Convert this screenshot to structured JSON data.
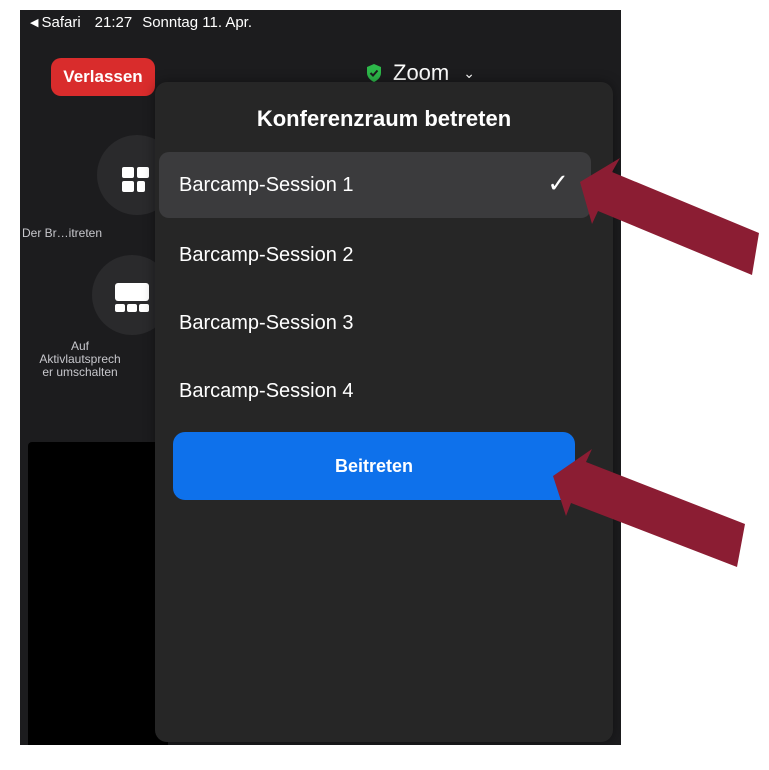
{
  "status_bar": {
    "back_app": "Safari",
    "time": "21:27",
    "date": "Sonntag 11. Apr."
  },
  "header": {
    "leave_label": "Verlassen",
    "meeting_title": "Zoom"
  },
  "side_buttons": {
    "breakout_label": "Der Br…itreten",
    "speaker_label_lines": [
      "Auf",
      "Aktivlautsprech",
      "er umschalten"
    ]
  },
  "modal": {
    "title": "Konferenzraum betreten",
    "rooms": [
      {
        "label": "Barcamp-Session 1",
        "selected": true
      },
      {
        "label": "Barcamp-Session 2",
        "selected": false
      },
      {
        "label": "Barcamp-Session 3",
        "selected": false
      },
      {
        "label": "Barcamp-Session 4",
        "selected": false
      }
    ],
    "join_label": "Beitreten"
  },
  "colors": {
    "leave": "#d92c2c",
    "join": "#0e71eb",
    "shield": "#2db84a",
    "arrow": "#8b1d33"
  }
}
